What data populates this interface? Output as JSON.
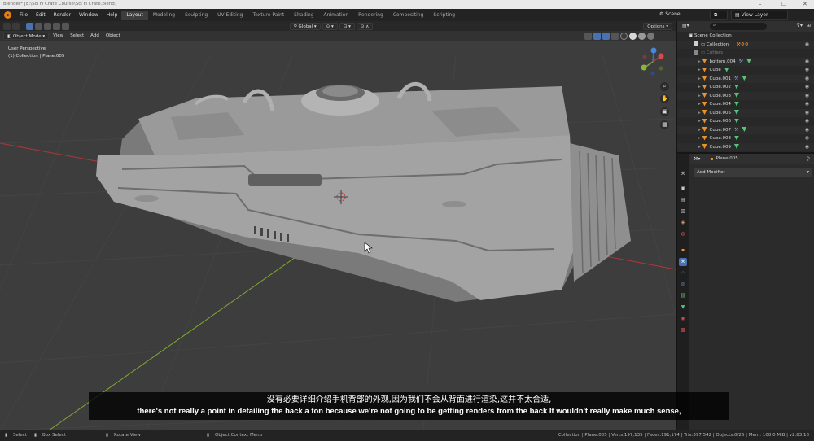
{
  "window": {
    "title": "Blender* [E:\\Sci Fi Crate Course\\Sci Fi Crate.blend]",
    "controls": [
      "minimize-icon",
      "maximize-icon",
      "close-icon"
    ]
  },
  "topbar": {
    "menus": [
      "File",
      "Edit",
      "Render",
      "Window",
      "Help"
    ],
    "workspaces": [
      "Layout",
      "Modeling",
      "Sculpting",
      "UV Editing",
      "Texture Paint",
      "Shading",
      "Animation",
      "Rendering",
      "Compositing",
      "Scripting"
    ],
    "active_workspace": "Layout",
    "scene": "Scene",
    "view_layer": "View Layer"
  },
  "viewport": {
    "mode": "Object Mode",
    "menus": [
      "View",
      "Select",
      "Add",
      "Object"
    ],
    "orientation": "Global",
    "options": "Options",
    "view_name": "User Perspective",
    "context": "(1) Collection | Plane.005"
  },
  "outliner": {
    "root": "Scene Collection",
    "rows": [
      {
        "name": "Collection",
        "kind": "collection"
      },
      {
        "name": "Cutters",
        "kind": "collection-muted"
      },
      {
        "name": "bottom.004",
        "kind": "mesh",
        "modifier": true
      },
      {
        "name": "Cube",
        "kind": "mesh",
        "modifier": false
      },
      {
        "name": "Cube.001",
        "kind": "mesh",
        "modifier": true
      },
      {
        "name": "Cube.002",
        "kind": "mesh",
        "modifier": false
      },
      {
        "name": "Cube.003",
        "kind": "mesh",
        "modifier": false
      },
      {
        "name": "Cube.004",
        "kind": "mesh",
        "modifier": false
      },
      {
        "name": "Cube.005",
        "kind": "mesh",
        "modifier": false
      },
      {
        "name": "Cube.006",
        "kind": "mesh",
        "modifier": false
      },
      {
        "name": "Cube.007",
        "kind": "mesh",
        "modifier": true
      },
      {
        "name": "Cube.008",
        "kind": "mesh",
        "modifier": false
      },
      {
        "name": "Cube.009",
        "kind": "mesh",
        "modifier": false
      }
    ]
  },
  "properties": {
    "object": "Plane.005",
    "add_modifier": "Add Modifier"
  },
  "statusbar": {
    "select": "Select",
    "box_select": "Box Select",
    "rotate_view": "Rotate View",
    "context_menu": "Object Context Menu",
    "stats": "Collection | Plane.005 | Verts:197,135 | Faces:191,174 | Tris:397,542 | Objects:0/26 | Mem: 108.0 MiB | v2.83.16"
  },
  "subtitle": {
    "zh": "没有必要详细介绍手机背部的外观,因为我们不会从背面进行渲染,这并不太合适,",
    "en": "there's not really a point in detailing the back a ton because we're not going to be getting renders from the back It wouldn't really make much sense,"
  },
  "colors": {
    "accent": "#4772b3",
    "object_orange": "#e8922d",
    "modifier_green": "#59c27a",
    "viewport_bg": "#3d3d3d",
    "x_axis": "#b2363b",
    "y_axis": "#7fa82d"
  }
}
